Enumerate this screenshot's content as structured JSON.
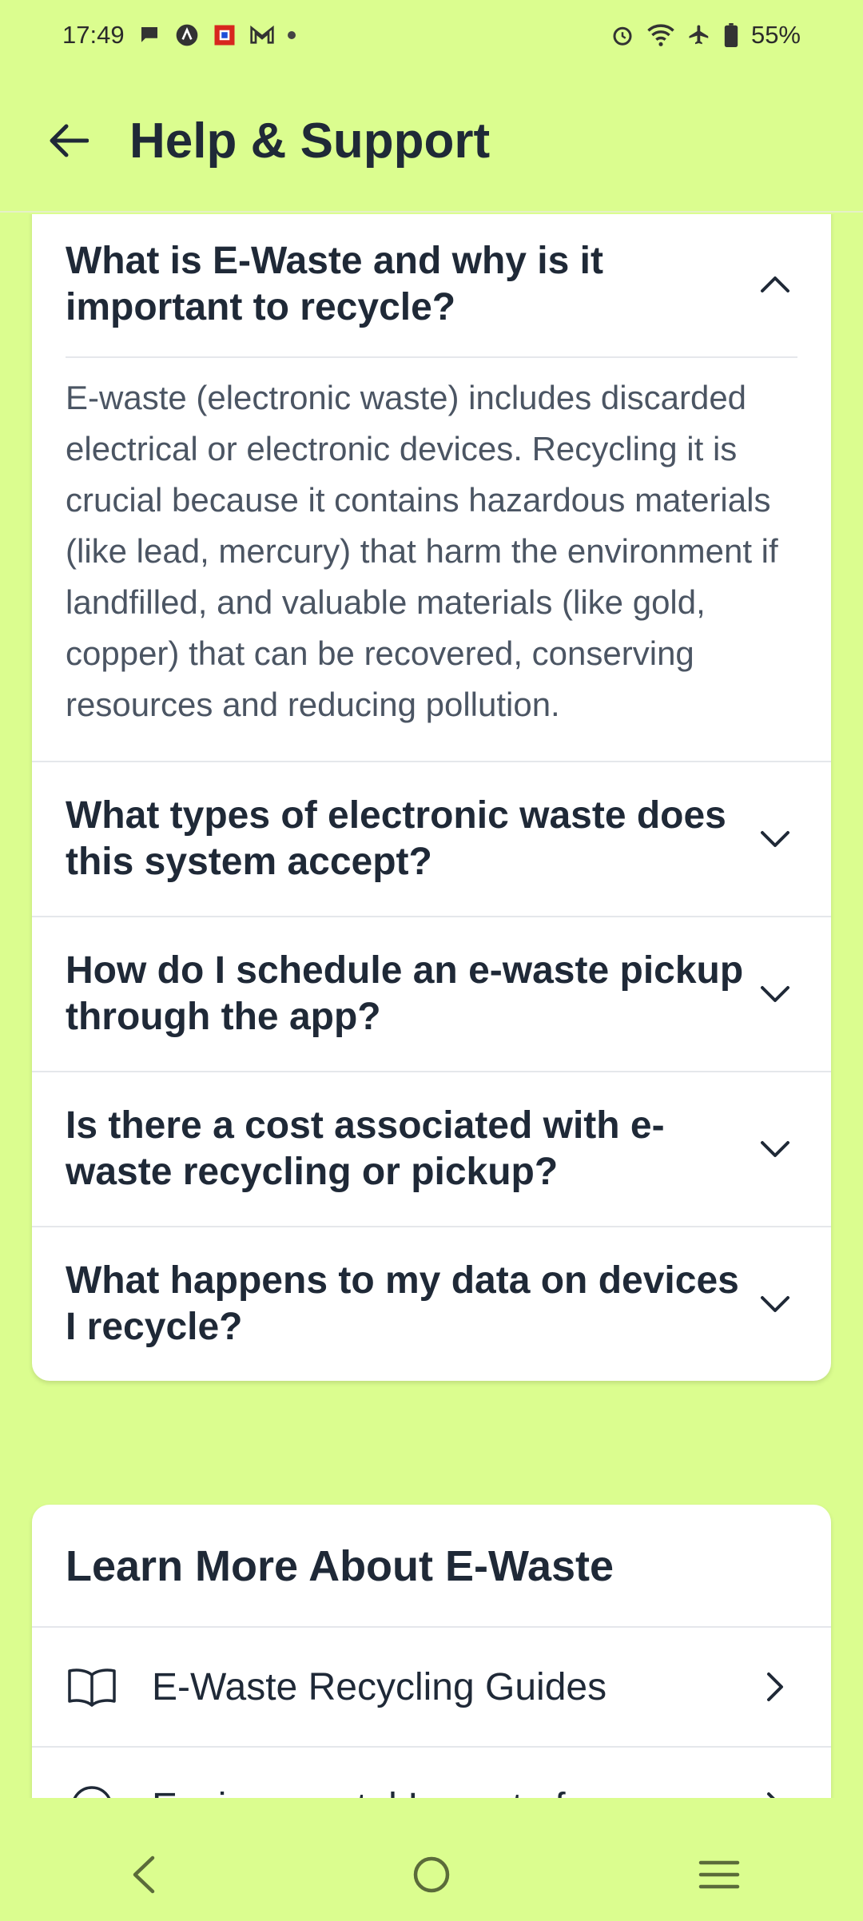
{
  "status_bar": {
    "time": "17:49",
    "battery": "55%",
    "left_icons": [
      "chat-icon",
      "app-icon",
      "app-icon-2",
      "gmail-icon",
      "dot"
    ],
    "right_icons": [
      "alarm-icon",
      "wifi-icon",
      "airplane-icon",
      "battery-icon"
    ]
  },
  "app_bar": {
    "title": "Help & Support"
  },
  "faq": {
    "items": [
      {
        "question": "What is E-Waste and why is it important to recycle?",
        "answer": "E-waste (electronic waste) includes discarded electrical or electronic devices. Recycling it is crucial because it contains hazardous materials (like lead, mercury) that harm the environment if landfilled, and valuable materials (like gold, copper) that can be recovered, conserving resources and reducing pollution.",
        "expanded": true
      },
      {
        "question": "What types of electronic waste does this system accept?",
        "expanded": false
      },
      {
        "question": "How do I schedule an e-waste pickup through the app?",
        "expanded": false
      },
      {
        "question": "Is there a cost associated with e-waste recycling or pickup?",
        "expanded": false
      },
      {
        "question": "What happens to my data on devices I recycle?",
        "expanded": false
      }
    ]
  },
  "learn_more": {
    "title": "Learn More About E-Waste",
    "items": [
      {
        "label": "E-Waste Recycling Guides",
        "icon": "book-icon"
      },
      {
        "label": "Environmental Impact of",
        "icon": "globe-icon"
      }
    ]
  },
  "colors": {
    "background": "#dbfd8f",
    "card": "#ffffff",
    "text": "#1f2937",
    "muted_text": "#4b5563"
  }
}
